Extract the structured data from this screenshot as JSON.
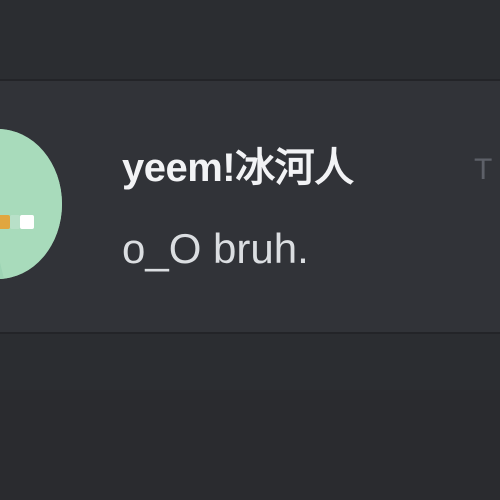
{
  "message": {
    "author": "yeem!冰河人",
    "timestamp": "T",
    "content": "o_O bruh."
  },
  "colors": {
    "background": "#313338",
    "secondary_background": "#2b2d31",
    "divider": "#232428",
    "username": "#f2f3f5",
    "text": "#dbdee1",
    "timestamp": "#5d6068",
    "avatar_bg": "#a8dbbb"
  },
  "icons": {
    "avatar": "user-avatar"
  }
}
